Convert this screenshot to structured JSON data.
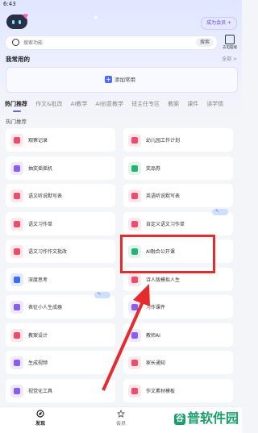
{
  "status": {
    "time": "6:43"
  },
  "header": {
    "vip_label": "成为会员 +"
  },
  "search": {
    "placeholder": "搜索功能",
    "button": "搜索",
    "scan_label": "去电脑端"
  },
  "common": {
    "title": "我常用的",
    "all_label": "全部 >",
    "add_label": "添加常用"
  },
  "tabs": [
    "热门推荐",
    "作文&批改",
    "AI教学",
    "AI创意教学",
    "班主任专区",
    "教案",
    "课件",
    "读学情"
  ],
  "hot_title": "热门推荐",
  "cards": [
    {
      "label": "观察记录",
      "color": "#f04b6a"
    },
    {
      "label": "幼儿园工作计划",
      "color": "#f04b6a"
    },
    {
      "label": "抽奖摇摇机",
      "color": "#8a5cf6"
    },
    {
      "label": "奖品券",
      "color": "#21b573"
    },
    {
      "label": "语文听说默写表",
      "color": "#f04b6a"
    },
    {
      "label": "英语听说默写表",
      "color": "#f04b6a"
    },
    {
      "label": "语文习作单",
      "color": "#f04b6a"
    },
    {
      "label": "自定义语文习作单",
      "color": "#f04b6a"
    },
    {
      "label": "语文习作作文批改",
      "color": "#f04b6a"
    },
    {
      "label": "AI融合公开课",
      "color": "#21b573"
    },
    {
      "label": "深度思考",
      "color": "#3b6bff"
    },
    {
      "label": "诗人版模拟人生",
      "color": "#f04b6a"
    },
    {
      "label": "表征小人生成器",
      "color": "#8a5cf6"
    },
    {
      "label": "习作课件",
      "color": "#8a5cf6"
    },
    {
      "label": "教案设计",
      "color": "#f04b6a"
    },
    {
      "label": "教师AI",
      "color": "#8a5cf6"
    },
    {
      "label": "生成视频",
      "color": "#8a5cf6"
    },
    {
      "label": "家长通知",
      "color": "#f04b6a"
    },
    {
      "label": "视觉化工具",
      "color": "#8a5cf6"
    },
    {
      "label": "作文素材模板",
      "color": "#f04b6a"
    }
  ],
  "nav": [
    {
      "label": "发现"
    },
    {
      "label": "会员"
    }
  ],
  "watermark": {
    "g": "谷",
    "text": "普软件园"
  }
}
